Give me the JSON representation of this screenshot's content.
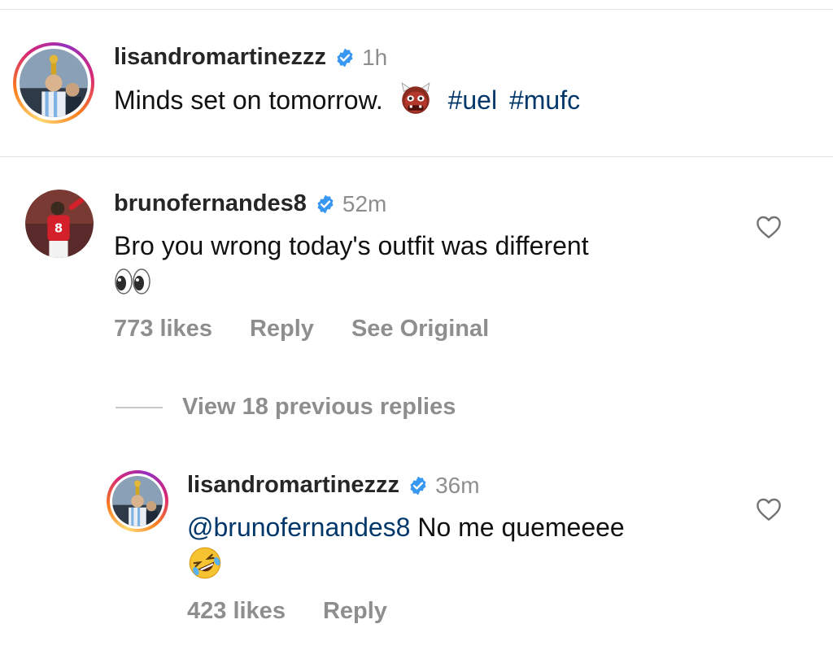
{
  "post": {
    "username": "lisandromartinezzz",
    "time": "1h",
    "caption": "Minds set on tomorrow.",
    "caption_emoji": "ogre-face",
    "hashtags": [
      "#uel",
      "#mufc"
    ]
  },
  "comments": [
    {
      "username": "brunofernandes8",
      "time": "52m",
      "text_line1": "Bro you wrong today's outfit was different",
      "text_emoji": "eyes",
      "likes": "773 likes",
      "reply_label": "Reply",
      "see_original_label": "See Original"
    }
  ],
  "view_replies_label": "View 18 previous replies",
  "replies": [
    {
      "username": "lisandromartinezzz",
      "time": "36m",
      "mention": "@brunofernandes8",
      "text": "No me quemeeee",
      "text_emoji": "rolling-on-floor-laughing",
      "likes": "423 likes",
      "reply_label": "Reply"
    }
  ],
  "colors": {
    "link": "#00376b",
    "secondary_text": "#8e8e8e",
    "verified": "#3897f0"
  }
}
